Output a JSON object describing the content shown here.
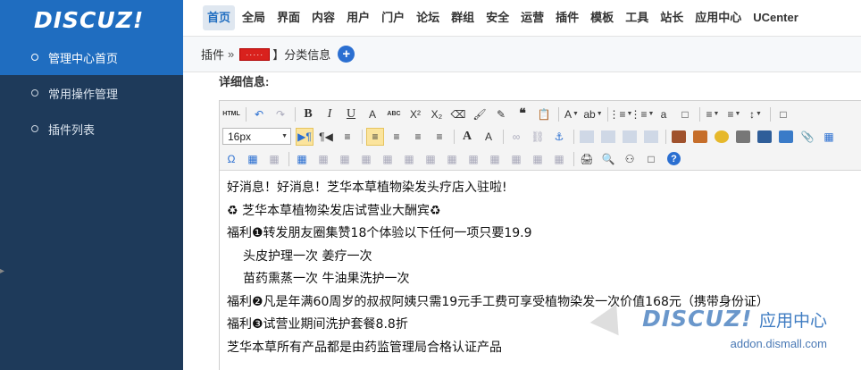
{
  "logo": {
    "text": "DISCUZ!"
  },
  "sidebar": {
    "items": [
      {
        "label": "管理中心首页",
        "active": true
      },
      {
        "label": "常用操作管理",
        "active": false
      },
      {
        "label": "插件列表",
        "active": false
      }
    ]
  },
  "topnav": {
    "items": [
      "首页",
      "全局",
      "界面",
      "内容",
      "用户",
      "门户",
      "论坛",
      "群组",
      "安全",
      "运营",
      "插件",
      "模板",
      "工具",
      "站长",
      "应用中心",
      "UCenter"
    ],
    "active_index": 0
  },
  "breadcrumb": {
    "root": "插件",
    "separator": "»",
    "tag": "·····",
    "page": "】分类信息",
    "add_button": "+"
  },
  "form": {
    "label": "详细信息:"
  },
  "editor": {
    "font_size": "16px",
    "toolbar": {
      "row1": [
        "HTML",
        "↶",
        "↷",
        "B",
        "I",
        "U",
        "A",
        "ABC",
        "X²",
        "X₂",
        "⌫",
        "🖌",
        "✎",
        "❝",
        "📋",
        "A",
        "ab",
        "⋮≡",
        "⋮≡",
        "a",
        "□",
        "≡",
        "≡",
        "↕",
        "□"
      ],
      "row2": [
        "▶¶",
        "¶◀",
        "≡",
        "≡",
        "≡",
        "≡",
        "≡",
        "A",
        "A",
        "∞",
        "⛓",
        "⚓"
      ],
      "row3": [
        "Ω",
        "▦",
        "▦",
        "▦",
        "▦",
        "▦",
        "▦",
        "▦",
        "▦",
        "▦",
        "▦",
        "▦",
        "▦",
        "▦",
        "▦",
        "▦",
        "🖨",
        "🔍",
        "⚇",
        "□"
      ]
    },
    "content": [
      "好消息！好消息！芝华本草植物染发头疗店入驻啦!",
      "♻  芝华本草植物染发店试营业大酬宾♻",
      "福利❶转发朋友圈集赞18个体验以下任何一项只要19.9",
      "头皮护理一次   姜疗一次",
      "苗药熏蒸一次   牛油果洗护一次",
      "福利❷凡是年满60周岁的叔叔阿姨只需19元手工费可享受植物染发一次价值168元（携带身份证）",
      "福利❸试营业期间洗护套餐8.8折",
      "芝华本草所有产品都是由药监管理局合格认证产品"
    ]
  },
  "watermark": {
    "logo": "DISCUZ!",
    "title": "应用中心",
    "url": "addon.dismall.com"
  },
  "colors": {
    "sidebar_bg": "#1e3a5a",
    "accent": "#1f6dc0",
    "active_tool": "#fbe49d"
  }
}
